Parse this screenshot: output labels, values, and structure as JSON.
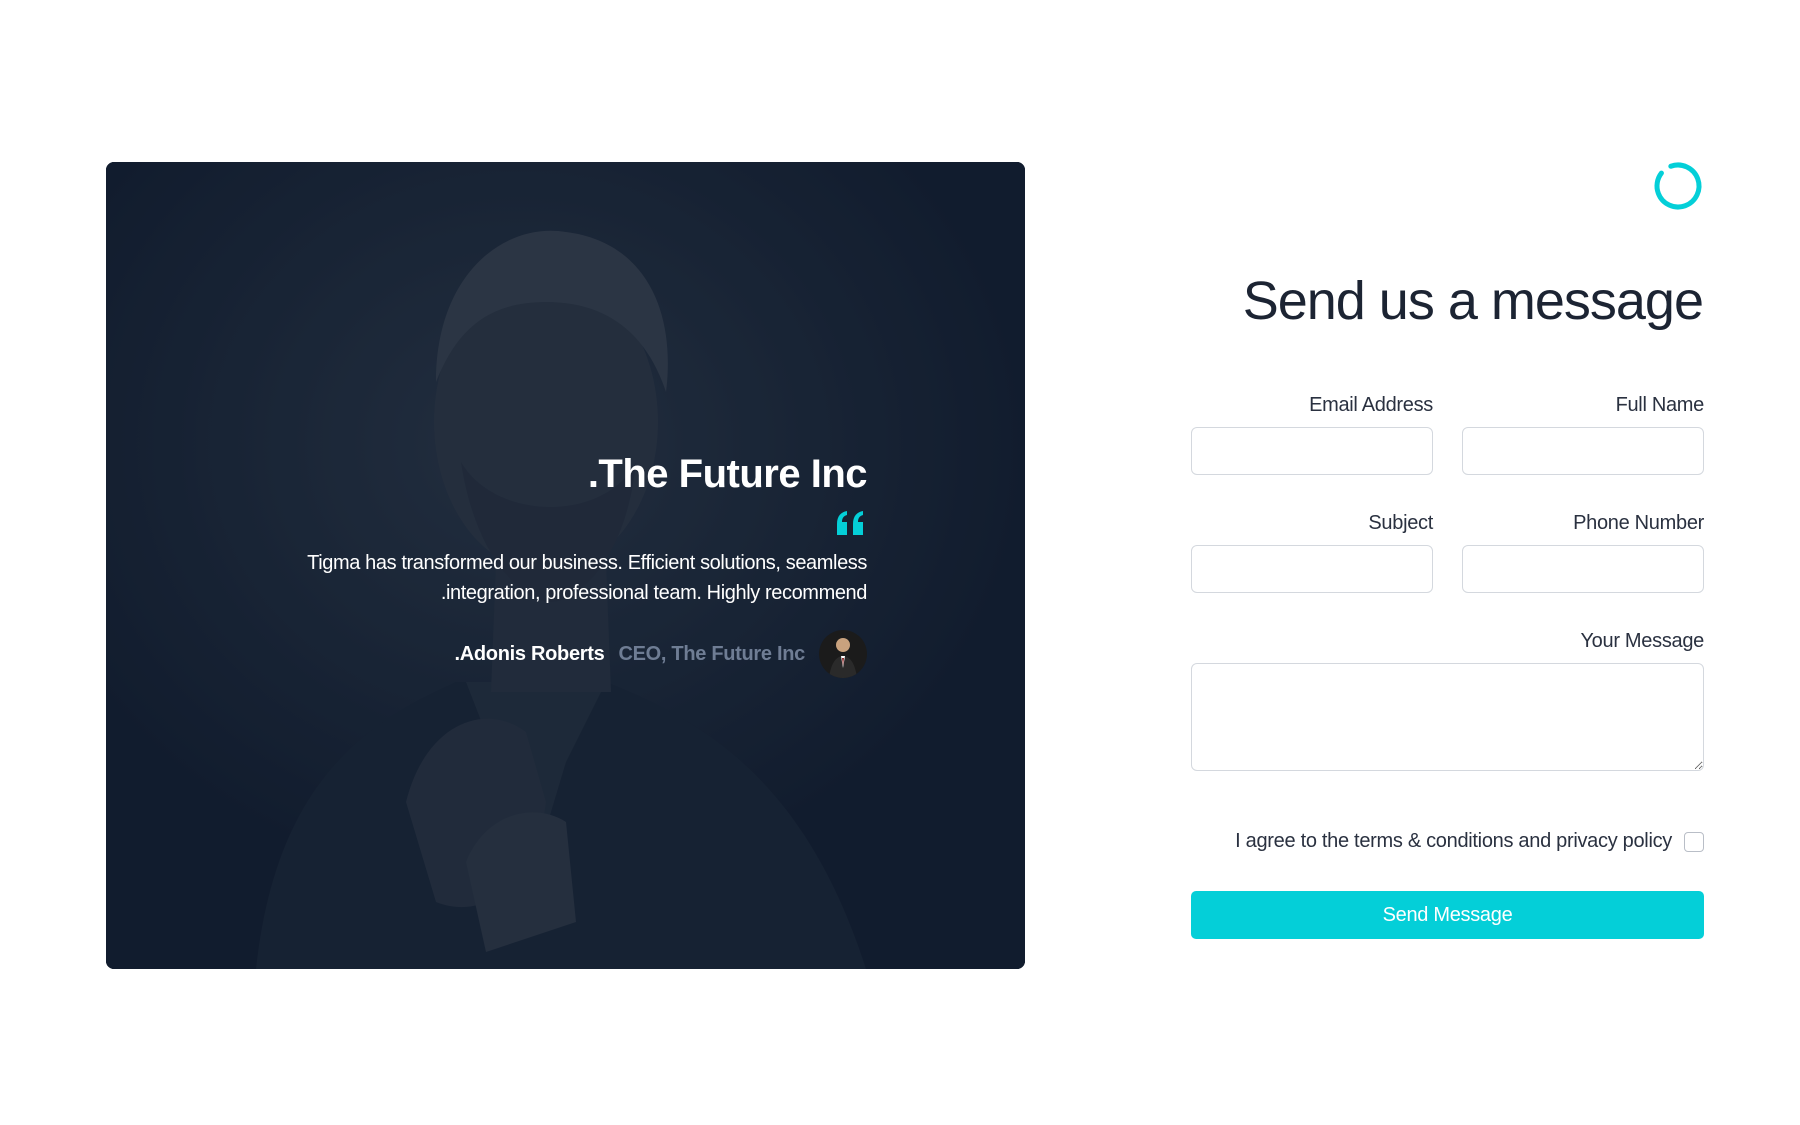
{
  "colors": {
    "accent": "#04cfd8",
    "card_background": "#121d2f",
    "muted_text": "#6f7d94",
    "heading": "#1c2433"
  },
  "testimonial_card": {
    "background_image": "person-portrait-photo",
    "company_title": ".The Future Inc",
    "quote_icon": "quote-icon",
    "text": "Tigma has transformed our business. Efficient solutions, seamless .integration, professional team. Highly recommend",
    "author_name": ".Adonis Roberts",
    "author_role": "CEO, The Future Inc",
    "author_avatar": "avatar"
  },
  "form": {
    "loader_icon": "loading-spinner-icon",
    "title": "Send us a message",
    "fields": {
      "email": {
        "label": "Email Address",
        "value": ""
      },
      "full_name": {
        "label": "Full Name",
        "value": ""
      },
      "subject": {
        "label": "Subject",
        "value": ""
      },
      "phone": {
        "label": "Phone Number",
        "value": ""
      },
      "message": {
        "label": "Your Message",
        "value": ""
      }
    },
    "agree_text": "I agree to the terms & conditions and privacy policy",
    "agree_checked": false,
    "submit_label": "Send Message"
  }
}
